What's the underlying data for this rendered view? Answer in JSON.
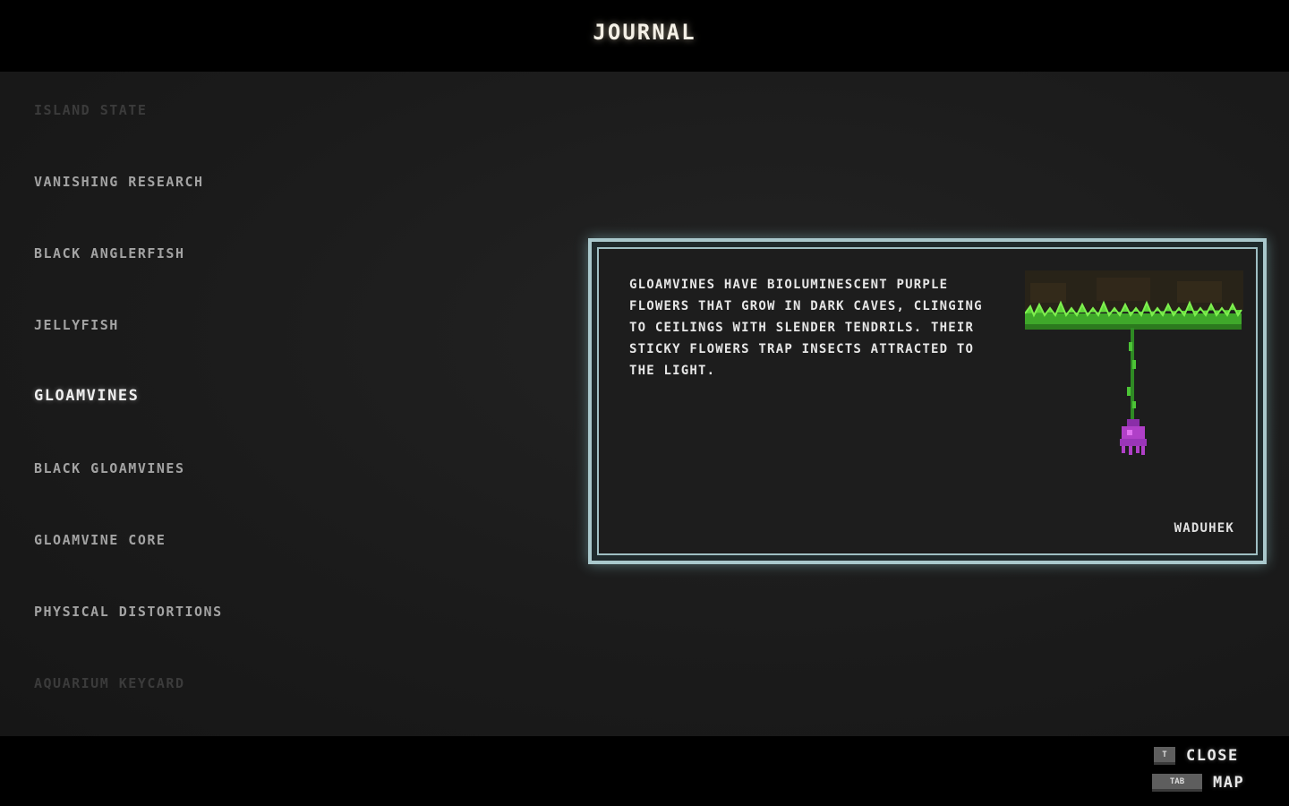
{
  "header": {
    "title": "JOURNAL"
  },
  "nav": {
    "items": [
      {
        "label": "ISLAND STATE",
        "state": "faded"
      },
      {
        "label": "VANISHING RESEARCH",
        "state": "normal"
      },
      {
        "label": "BLACK ANGLERFISH",
        "state": "normal"
      },
      {
        "label": "JELLYFISH",
        "state": "normal"
      },
      {
        "label": "GLOAMVINES",
        "state": "selected"
      },
      {
        "label": "BLACK GLOAMVINES",
        "state": "normal"
      },
      {
        "label": "GLOAMVINE CORE",
        "state": "normal"
      },
      {
        "label": "PHYSICAL DISTORTIONS",
        "state": "normal"
      },
      {
        "label": "AQUARIUM KEYCARD",
        "state": "faded"
      }
    ]
  },
  "entry": {
    "text": "GLOAMVINES HAVE BIOLUMINESCENT PURPLE FLOWERS THAT GROW IN DARK CAVES, CLINGING TO CEILINGS WITH SLENDER TENDRILS. THEIR STICKY FLOWERS TRAP INSECTS ATTRACTED TO THE LIGHT.",
    "author": "WADUHEK",
    "illustration_icon": "gloamvine-illustration"
  },
  "controls": {
    "close": {
      "key": "T",
      "label": "CLOSE"
    },
    "map": {
      "key": "TAB",
      "label": "MAP"
    }
  },
  "colors": {
    "panel_border": "#a9c8cc",
    "vine_green": "#5fd83a",
    "flower_purple": "#b040c8"
  }
}
